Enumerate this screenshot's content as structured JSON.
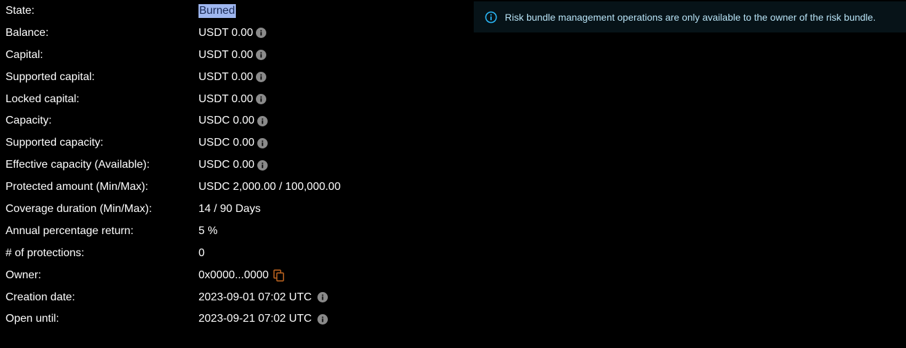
{
  "details": {
    "rows": [
      {
        "label": "State:",
        "value": "Burned"
      },
      {
        "label": "Balance:",
        "value": "USDT 0.00"
      },
      {
        "label": "Capital:",
        "value": "USDT 0.00"
      },
      {
        "label": "Supported capital:",
        "value": "USDT 0.00"
      },
      {
        "label": "Locked capital:",
        "value": "USDT 0.00"
      },
      {
        "label": "Capacity:",
        "value": "USDC 0.00"
      },
      {
        "label": "Supported capacity:",
        "value": "USDC 0.00"
      },
      {
        "label": "Effective capacity (Available):",
        "value": "USDC 0.00"
      },
      {
        "label": "Protected amount (Min/Max):",
        "value": "USDC 2,000.00 / 100,000.00"
      },
      {
        "label": "Coverage duration (Min/Max):",
        "value": "14 / 90 Days"
      },
      {
        "label": "Annual percentage return:",
        "value": "5 %"
      },
      {
        "label": "# of protections:",
        "value": "0"
      },
      {
        "label": "Owner:",
        "value": "0x0000...0000"
      },
      {
        "label": "Creation date:",
        "value": "2023-09-01 07:02 UTC"
      },
      {
        "label": "Open until:",
        "value": "2023-09-21 07:02 UTC"
      }
    ]
  },
  "alert": {
    "message": "Risk bundle management operations are only available to the owner of the risk bundle.",
    "icon": "info-outline-icon",
    "color": "#29b6f6"
  },
  "colors": {
    "background": "#000000",
    "state_highlight": "#9fb7f0",
    "info_icon": "#8a8a8a",
    "copy_icon": "#b9621f",
    "alert_background": "#071318",
    "alert_text": "#b8e3f6"
  }
}
